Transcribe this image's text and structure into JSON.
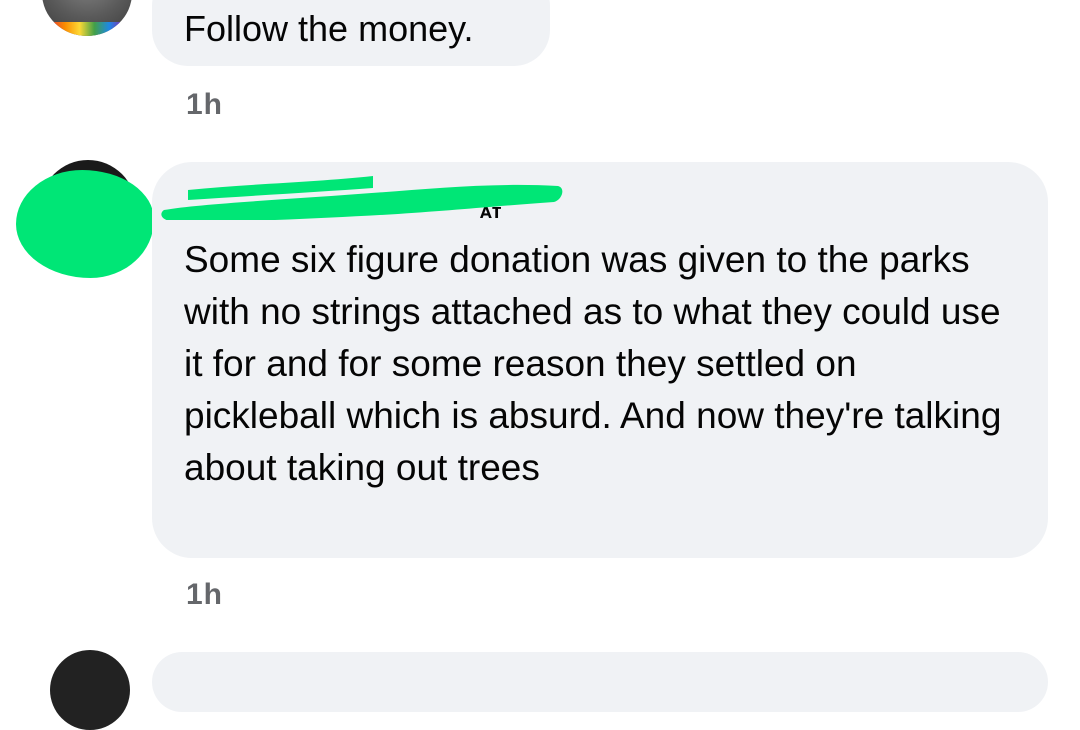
{
  "comments": [
    {
      "text": "Follow the money.",
      "time": "1h"
    },
    {
      "author_name_tail": "ᴀᴛ",
      "text": "Some six figure donation was given to the parks with no strings attached as to what they could use it for and for some reason they settled on pickleball which is absurd. And now they're talking about taking out trees",
      "time": "1h"
    }
  ],
  "colors": {
    "bubble": "#f0f2f5",
    "redaction": "#00e676",
    "timestamp": "#65676b"
  }
}
